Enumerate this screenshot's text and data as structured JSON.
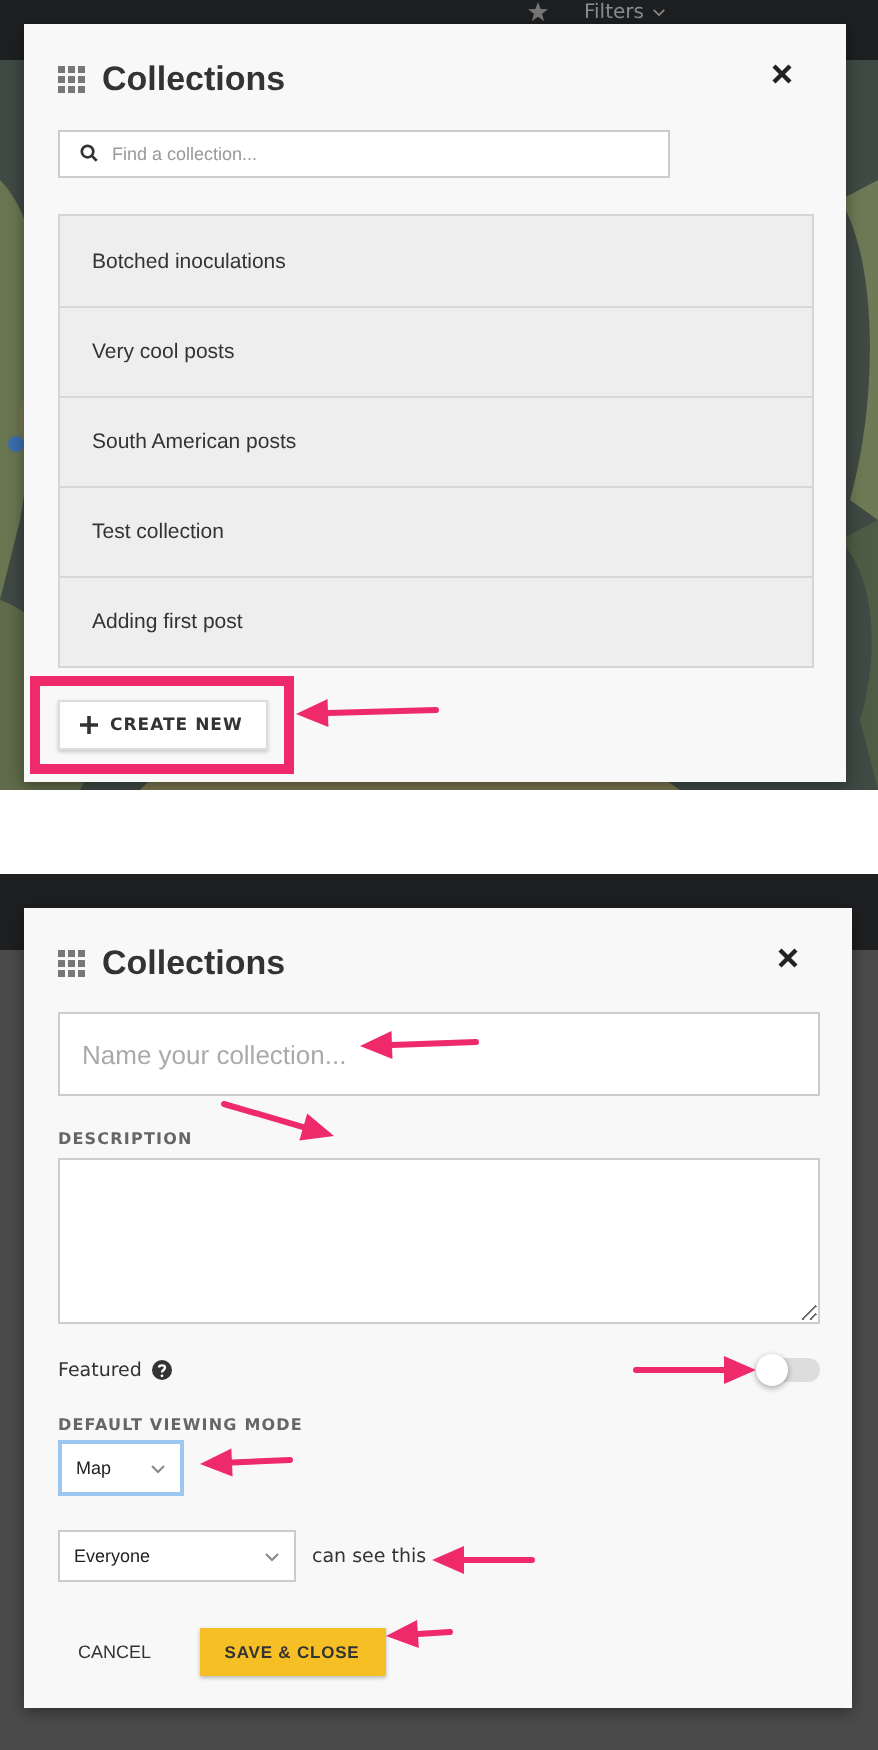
{
  "list_screen": {
    "top_bar": {
      "filter_label": "Filters"
    },
    "modal": {
      "title": "Collections",
      "search": {
        "placeholder": "Find a collection..."
      },
      "collections": [
        {
          "name": "Botched inoculations"
        },
        {
          "name": "Very cool posts"
        },
        {
          "name": "South American posts"
        },
        {
          "name": "Test collection"
        },
        {
          "name": "Adding first post"
        }
      ],
      "create_button": "CREATE NEW"
    }
  },
  "form_screen": {
    "modal": {
      "title": "Collections",
      "name_field": {
        "placeholder": "Name your collection..."
      },
      "description_label": "DESCRIPTION",
      "featured": {
        "label": "Featured",
        "on": false
      },
      "view_mode": {
        "label": "DEFAULT VIEWING MODE",
        "value": "Map",
        "focused": true
      },
      "visibility": {
        "value": "Everyone",
        "suffix": "can see this"
      },
      "cancel_button": "CANCEL",
      "save_button": "SAVE & CLOSE"
    }
  }
}
